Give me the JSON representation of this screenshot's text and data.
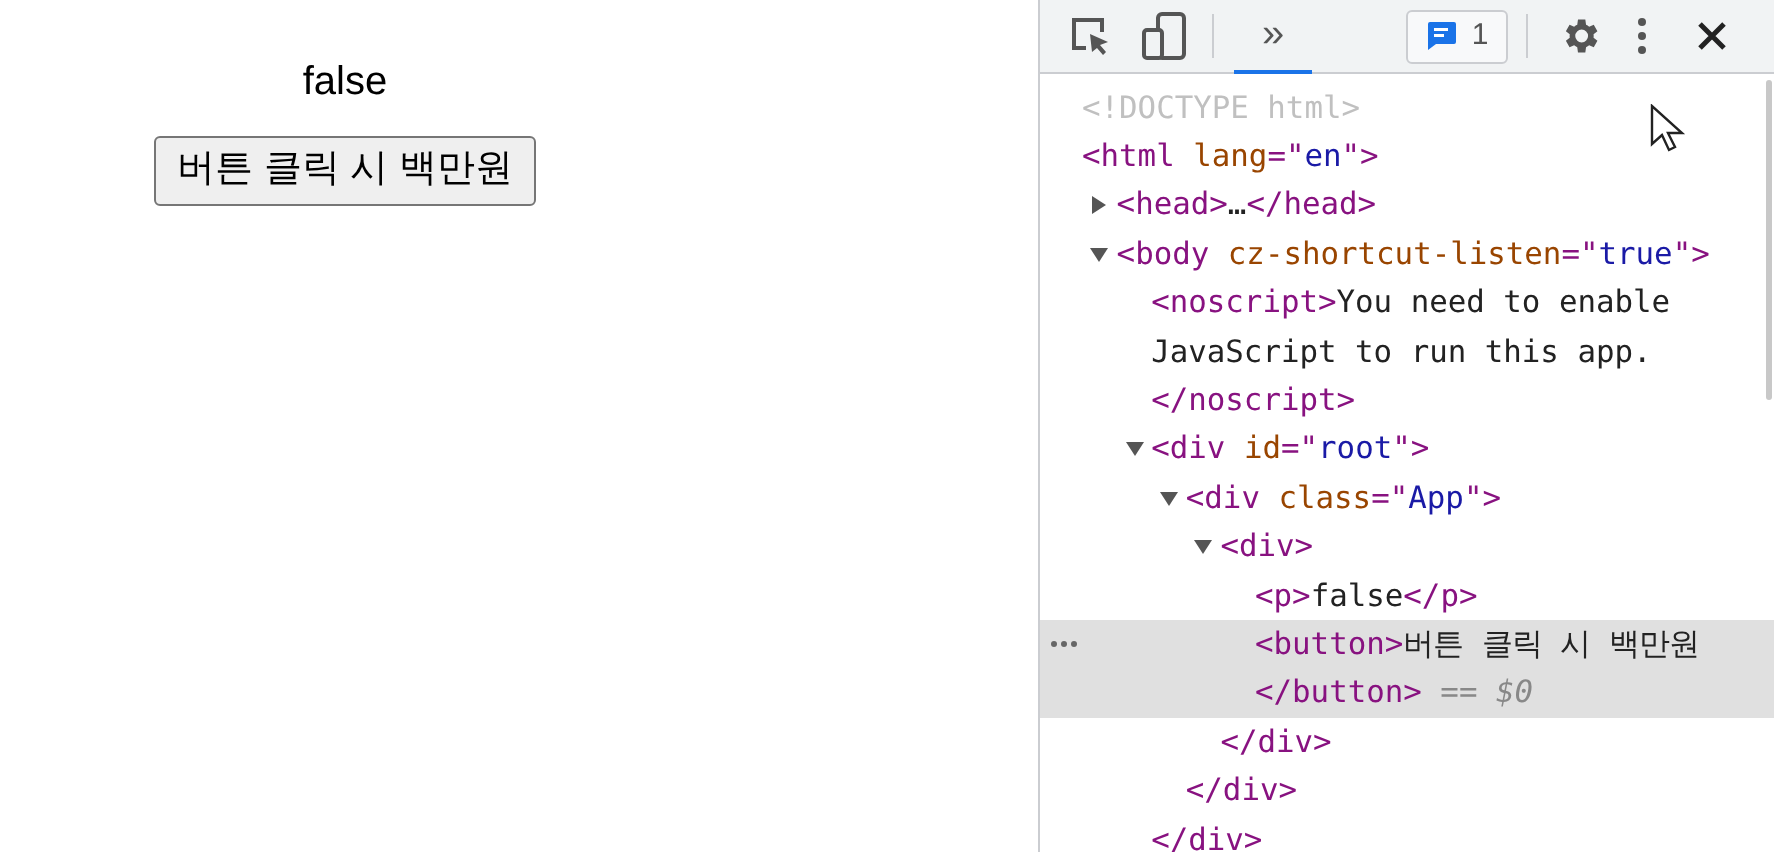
{
  "page": {
    "status_text": "false",
    "button_label": "버튼 클릭 시 백만원"
  },
  "devtools": {
    "more_tabs": {
      "label": "»",
      "selected": true
    },
    "issues_badge": {
      "count": "1"
    },
    "tree": [
      {
        "lines": [
          [
            {
              "kind": "doctype",
              "text": "<!DOCTYPE html>"
            }
          ]
        ]
      },
      {
        "lines": [
          [
            {
              "kind": "tag",
              "text": "<html "
            },
            {
              "kind": "attr",
              "text": "lang"
            },
            {
              "kind": "tag",
              "text": "=\""
            },
            {
              "kind": "value",
              "text": "en"
            },
            {
              "kind": "tag",
              "text": "\">"
            }
          ]
        ],
        "children": [
          {
            "expanded": false,
            "lines": [
              [
                {
                  "kind": "tag",
                  "text": "<head>"
                },
                {
                  "kind": "text",
                  "text": "…"
                },
                {
                  "kind": "tag",
                  "text": "</head>"
                }
              ]
            ]
          },
          {
            "expanded": true,
            "lines": [
              [
                {
                  "kind": "tag",
                  "text": "<body "
                },
                {
                  "kind": "attr",
                  "text": "cz-shortcut-listen"
                },
                {
                  "kind": "tag",
                  "text": "=\""
                },
                {
                  "kind": "value",
                  "text": "true"
                },
                {
                  "kind": "tag",
                  "text": "\">"
                }
              ]
            ],
            "children": [
              {
                "lines": [
                  [
                    {
                      "kind": "tag",
                      "text": "<noscript>"
                    },
                    {
                      "kind": "text",
                      "text": "You need to enable"
                    }
                  ],
                  [
                    {
                      "kind": "text",
                      "text": "JavaScript to run this app."
                    }
                  ],
                  [
                    {
                      "kind": "tag",
                      "text": "</noscript>"
                    }
                  ]
                ]
              },
              {
                "expanded": true,
                "lines": [
                  [
                    {
                      "kind": "tag",
                      "text": "<div "
                    },
                    {
                      "kind": "attr",
                      "text": "id"
                    },
                    {
                      "kind": "tag",
                      "text": "=\""
                    },
                    {
                      "kind": "value",
                      "text": "root"
                    },
                    {
                      "kind": "tag",
                      "text": "\">"
                    }
                  ]
                ],
                "close": [
                  [
                    {
                      "kind": "tag",
                      "text": "</div>"
                    }
                  ]
                ],
                "children": [
                  {
                    "expanded": true,
                    "lines": [
                      [
                        {
                          "kind": "tag",
                          "text": "<div "
                        },
                        {
                          "kind": "attr",
                          "text": "class"
                        },
                        {
                          "kind": "tag",
                          "text": "=\""
                        },
                        {
                          "kind": "value",
                          "text": "App"
                        },
                        {
                          "kind": "tag",
                          "text": "\">"
                        }
                      ]
                    ],
                    "close": [
                      [
                        {
                          "kind": "tag",
                          "text": "</div>"
                        }
                      ]
                    ],
                    "children": [
                      {
                        "expanded": true,
                        "lines": [
                          [
                            {
                              "kind": "tag",
                              "text": "<div>"
                            }
                          ]
                        ],
                        "close": [
                          [
                            {
                              "kind": "tag",
                              "text": "</div>"
                            }
                          ]
                        ],
                        "children": [
                          {
                            "lines": [
                              [
                                {
                                  "kind": "tag",
                                  "text": "<p>"
                                },
                                {
                                  "kind": "text",
                                  "text": "false"
                                },
                                {
                                  "kind": "tag",
                                  "text": "</p>"
                                }
                              ]
                            ]
                          },
                          {
                            "selected": true,
                            "lines": [
                              [
                                {
                                  "kind": "tag",
                                  "text": "<button>"
                                },
                                {
                                  "kind": "text",
                                  "text": "버튼 클릭 시 백만원"
                                }
                              ],
                              [
                                {
                                  "kind": "tag",
                                  "text": "</button>"
                                },
                                {
                                  "kind": "hint",
                                  "text": " == $0"
                                }
                              ]
                            ]
                          }
                        ]
                      }
                    ]
                  }
                ]
              }
            ]
          }
        ]
      }
    ]
  }
}
